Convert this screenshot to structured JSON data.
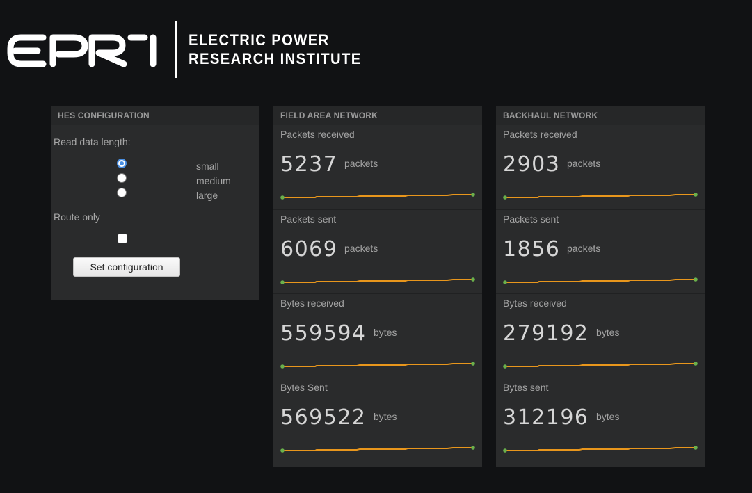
{
  "header": {
    "logo_text": "EPRI",
    "org_line1": "ELECTRIC POWER",
    "org_line2": "RESEARCH INSTITUTE"
  },
  "hes": {
    "title": "HES CONFIGURATION",
    "read_label": "Read data length:",
    "options": [
      {
        "label": "small",
        "checked": true
      },
      {
        "label": "medium",
        "checked": false
      },
      {
        "label": "large",
        "checked": false
      }
    ],
    "route_label": "Route only",
    "route_checked": false,
    "button_label": "Set configuration"
  },
  "field_area": {
    "title": "FIELD AREA NETWORK",
    "metrics": [
      {
        "label": "Packets received",
        "value": "5237",
        "unit": "packets"
      },
      {
        "label": "Packets sent",
        "value": "6069",
        "unit": "packets"
      },
      {
        "label": "Bytes received",
        "value": "559594",
        "unit": "bytes"
      },
      {
        "label": "Bytes Sent",
        "value": "569522",
        "unit": "bytes"
      }
    ]
  },
  "backhaul": {
    "title": "BACKHAUL NETWORK",
    "metrics": [
      {
        "label": "Packets received",
        "value": "2903",
        "unit": "packets"
      },
      {
        "label": "Packets sent",
        "value": "1856",
        "unit": "packets"
      },
      {
        "label": "Bytes received",
        "value": "279192",
        "unit": "bytes"
      },
      {
        "label": "Bytes sent",
        "value": "312196",
        "unit": "bytes"
      }
    ]
  },
  "colors": {
    "sparkline": "#e8961c",
    "sparkline_dot": "#6ab04c",
    "accent": "#4a8fe2"
  }
}
